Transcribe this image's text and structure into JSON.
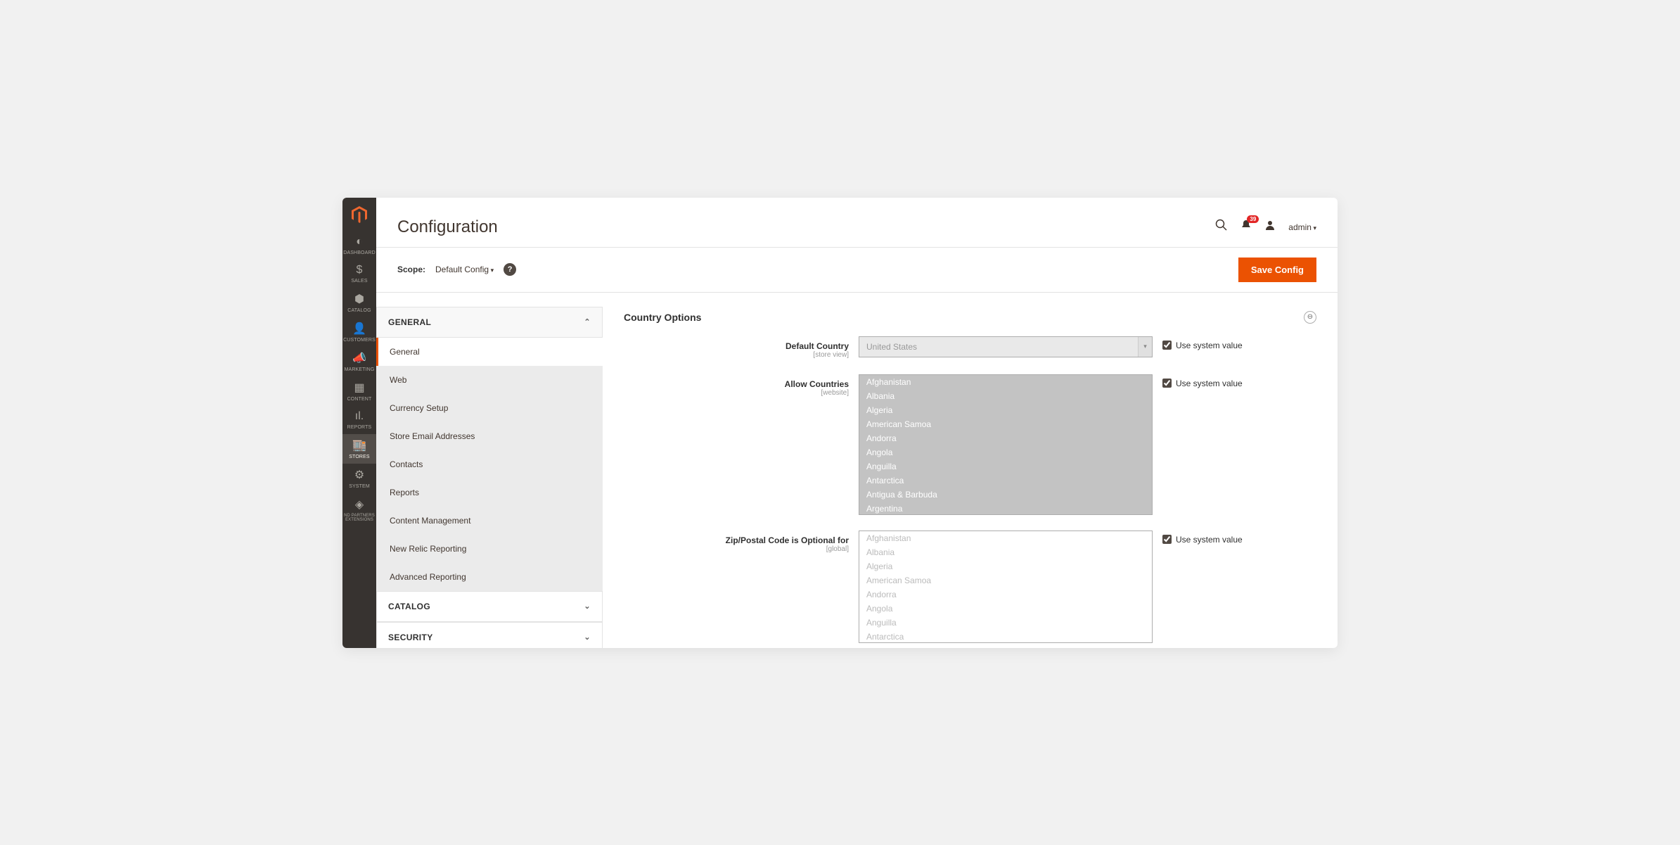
{
  "header": {
    "title": "Configuration",
    "badge": "39",
    "user": "admin"
  },
  "scope": {
    "label": "Scope:",
    "value": "Default Config",
    "save": "Save Config"
  },
  "nav": {
    "dashboard": "DASHBOARD",
    "sales": "SALES",
    "catalog": "CATALOG",
    "customers": "CUSTOMERS",
    "marketing": "MARKETING",
    "content": "CONTENT",
    "reports": "REPORTS",
    "stores": "STORES",
    "system": "SYSTEM",
    "partners": "ND PARTNERS EXTENSIONS"
  },
  "cfg": {
    "general": "GENERAL",
    "items": {
      "general": "General",
      "web": "Web",
      "currency": "Currency Setup",
      "email": "Store Email Addresses",
      "contacts": "Contacts",
      "reports": "Reports",
      "cms": "Content Management",
      "newrelic": "New Relic Reporting",
      "adv": "Advanced Reporting"
    },
    "catalog": "CATALOG",
    "security": "SECURITY"
  },
  "group": {
    "title": "Country Options"
  },
  "fields": {
    "default_country": {
      "label": "Default Country",
      "scope": "[store view]",
      "value": "United States"
    },
    "allow": {
      "label": "Allow Countries",
      "scope": "[website]"
    },
    "zip": {
      "label": "Zip/Postal Code is Optional for",
      "scope": "[global]"
    }
  },
  "use_system": "Use system value",
  "countries": [
    "Afghanistan",
    "Albania",
    "Algeria",
    "American Samoa",
    "Andorra",
    "Angola",
    "Anguilla",
    "Antarctica",
    "Antigua & Barbuda",
    "Argentina"
  ],
  "countries2": [
    "Afghanistan",
    "Albania",
    "Algeria",
    "American Samoa",
    "Andorra",
    "Angola",
    "Anguilla",
    "Antarctica"
  ]
}
